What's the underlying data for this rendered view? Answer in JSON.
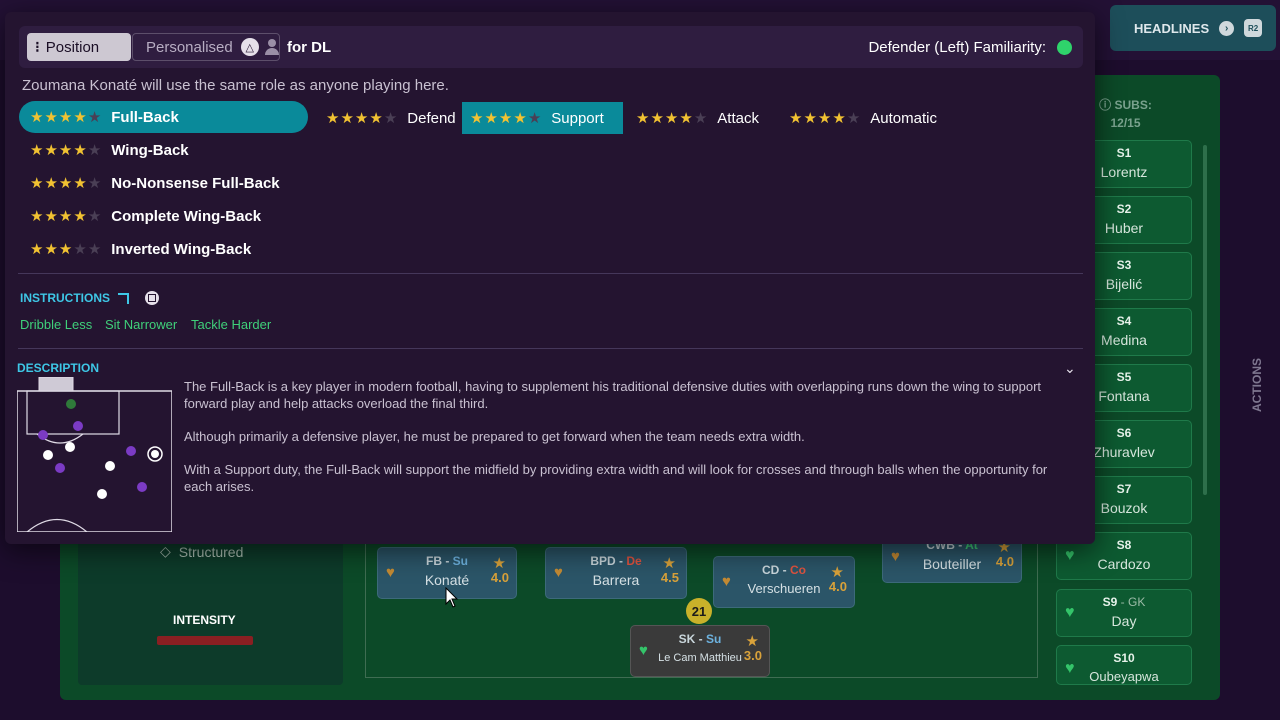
{
  "background": {
    "headlines": {
      "label": "HEADLINES",
      "badge": "R2"
    },
    "mentality": "Structured",
    "intensity_label": "INTENSITY",
    "intensity_level": 0.6,
    "subs": {
      "label": "SUBS:",
      "count": "12/15"
    },
    "actions_label": "ACTIONS",
    "players": [
      {
        "role": "FB",
        "duty": "Su",
        "duty_color": "#6db3e0",
        "name": "Konaté",
        "rating": "4.0"
      },
      {
        "role": "BPD",
        "duty": "De",
        "duty_color": "#e0533f",
        "name": "Barrera",
        "rating": "4.5"
      },
      {
        "role": "CD",
        "duty": "Co",
        "duty_color": "#e0533f",
        "name": "Verschueren",
        "rating": "4.0"
      },
      {
        "role": "CWB",
        "duty": "At",
        "duty_color": "#3fd07a",
        "name": "Bouteiller",
        "rating": "4.0"
      },
      {
        "role": "SK",
        "duty": "Su",
        "duty_color": "#6db3e0",
        "name": "Le Cam Matthieu",
        "rating": "3.0"
      }
    ],
    "shirt_number": "21",
    "substitutes": [
      {
        "id": "S1",
        "pos": "",
        "name": "Lorentz"
      },
      {
        "id": "S2",
        "pos": "",
        "name": "Huber"
      },
      {
        "id": "S3",
        "pos": "",
        "name": "Bijelić"
      },
      {
        "id": "S4",
        "pos": "",
        "name": "Medina"
      },
      {
        "id": "S5",
        "pos": "",
        "name": "Fontana"
      },
      {
        "id": "S6",
        "pos": "",
        "name": "Zhuravlev"
      },
      {
        "id": "S7",
        "pos": "",
        "name": "Bouzok"
      },
      {
        "id": "S8",
        "pos": "",
        "name": "Cardozo"
      },
      {
        "id": "S9",
        "pos": "- GK",
        "name": "Day"
      },
      {
        "id": "S10",
        "pos": "",
        "name": "Oubeyapwa"
      }
    ]
  },
  "modal": {
    "tabs": {
      "position": "Position",
      "personalised": "Personalised"
    },
    "for_label": "for DL",
    "familiarity_label": "Defender (Left) Familiarity:",
    "familiarity_color": "#2fd36b",
    "role_note": "Zoumana Konaté will use the same role as anyone playing here.",
    "roles": [
      {
        "name": "Full-Back",
        "stars": 4,
        "selected": true
      },
      {
        "name": "Wing-Back",
        "stars": 4,
        "selected": false
      },
      {
        "name": "No-Nonsense Full-Back",
        "stars": 4,
        "selected": false
      },
      {
        "name": "Complete Wing-Back",
        "stars": 4,
        "selected": false
      },
      {
        "name": "Inverted Wing-Back",
        "stars": 3,
        "selected": false
      }
    ],
    "duties": [
      {
        "name": "Defend",
        "stars": 4,
        "selected": false
      },
      {
        "name": "Support",
        "stars": 4,
        "selected": true
      },
      {
        "name": "Attack",
        "stars": 4,
        "selected": false
      },
      {
        "name": "Automatic",
        "stars": 4,
        "selected": false
      }
    ],
    "instructions_title": "INSTRUCTIONS",
    "instructions": [
      "Dribble Less",
      "Sit Narrower",
      "Tackle Harder"
    ],
    "description_title": "DESCRIPTION",
    "description": [
      "The Full-Back is a key player in modern football, having to supplement his traditional defensive duties with overlapping runs down the wing to support forward play and help attacks overload the final third.",
      "Although primarily a defensive player, he must be prepared to get forward when the team needs extra width.",
      "With a Support duty, the Full-Back will support the midfield by providing extra width and will look for crosses and through balls when the opportunity for each arises."
    ]
  }
}
